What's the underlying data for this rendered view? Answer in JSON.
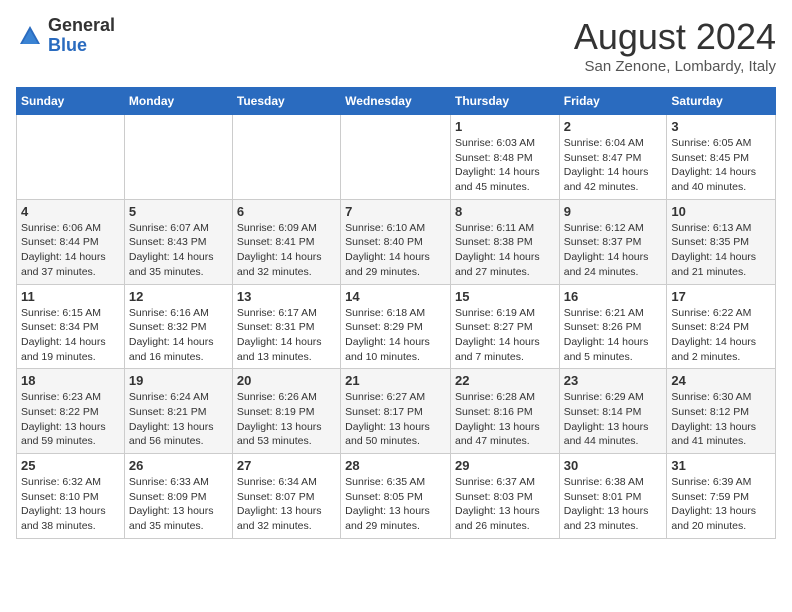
{
  "logo": {
    "general": "General",
    "blue": "Blue"
  },
  "header": {
    "title": "August 2024",
    "subtitle": "San Zenone, Lombardy, Italy"
  },
  "days_of_week": [
    "Sunday",
    "Monday",
    "Tuesday",
    "Wednesday",
    "Thursday",
    "Friday",
    "Saturday"
  ],
  "weeks": [
    [
      {
        "day": "",
        "info": ""
      },
      {
        "day": "",
        "info": ""
      },
      {
        "day": "",
        "info": ""
      },
      {
        "day": "",
        "info": ""
      },
      {
        "day": "1",
        "info": "Sunrise: 6:03 AM\nSunset: 8:48 PM\nDaylight: 14 hours and 45 minutes."
      },
      {
        "day": "2",
        "info": "Sunrise: 6:04 AM\nSunset: 8:47 PM\nDaylight: 14 hours and 42 minutes."
      },
      {
        "day": "3",
        "info": "Sunrise: 6:05 AM\nSunset: 8:45 PM\nDaylight: 14 hours and 40 minutes."
      }
    ],
    [
      {
        "day": "4",
        "info": "Sunrise: 6:06 AM\nSunset: 8:44 PM\nDaylight: 14 hours and 37 minutes."
      },
      {
        "day": "5",
        "info": "Sunrise: 6:07 AM\nSunset: 8:43 PM\nDaylight: 14 hours and 35 minutes."
      },
      {
        "day": "6",
        "info": "Sunrise: 6:09 AM\nSunset: 8:41 PM\nDaylight: 14 hours and 32 minutes."
      },
      {
        "day": "7",
        "info": "Sunrise: 6:10 AM\nSunset: 8:40 PM\nDaylight: 14 hours and 29 minutes."
      },
      {
        "day": "8",
        "info": "Sunrise: 6:11 AM\nSunset: 8:38 PM\nDaylight: 14 hours and 27 minutes."
      },
      {
        "day": "9",
        "info": "Sunrise: 6:12 AM\nSunset: 8:37 PM\nDaylight: 14 hours and 24 minutes."
      },
      {
        "day": "10",
        "info": "Sunrise: 6:13 AM\nSunset: 8:35 PM\nDaylight: 14 hours and 21 minutes."
      }
    ],
    [
      {
        "day": "11",
        "info": "Sunrise: 6:15 AM\nSunset: 8:34 PM\nDaylight: 14 hours and 19 minutes."
      },
      {
        "day": "12",
        "info": "Sunrise: 6:16 AM\nSunset: 8:32 PM\nDaylight: 14 hours and 16 minutes."
      },
      {
        "day": "13",
        "info": "Sunrise: 6:17 AM\nSunset: 8:31 PM\nDaylight: 14 hours and 13 minutes."
      },
      {
        "day": "14",
        "info": "Sunrise: 6:18 AM\nSunset: 8:29 PM\nDaylight: 14 hours and 10 minutes."
      },
      {
        "day": "15",
        "info": "Sunrise: 6:19 AM\nSunset: 8:27 PM\nDaylight: 14 hours and 7 minutes."
      },
      {
        "day": "16",
        "info": "Sunrise: 6:21 AM\nSunset: 8:26 PM\nDaylight: 14 hours and 5 minutes."
      },
      {
        "day": "17",
        "info": "Sunrise: 6:22 AM\nSunset: 8:24 PM\nDaylight: 14 hours and 2 minutes."
      }
    ],
    [
      {
        "day": "18",
        "info": "Sunrise: 6:23 AM\nSunset: 8:22 PM\nDaylight: 13 hours and 59 minutes."
      },
      {
        "day": "19",
        "info": "Sunrise: 6:24 AM\nSunset: 8:21 PM\nDaylight: 13 hours and 56 minutes."
      },
      {
        "day": "20",
        "info": "Sunrise: 6:26 AM\nSunset: 8:19 PM\nDaylight: 13 hours and 53 minutes."
      },
      {
        "day": "21",
        "info": "Sunrise: 6:27 AM\nSunset: 8:17 PM\nDaylight: 13 hours and 50 minutes."
      },
      {
        "day": "22",
        "info": "Sunrise: 6:28 AM\nSunset: 8:16 PM\nDaylight: 13 hours and 47 minutes."
      },
      {
        "day": "23",
        "info": "Sunrise: 6:29 AM\nSunset: 8:14 PM\nDaylight: 13 hours and 44 minutes."
      },
      {
        "day": "24",
        "info": "Sunrise: 6:30 AM\nSunset: 8:12 PM\nDaylight: 13 hours and 41 minutes."
      }
    ],
    [
      {
        "day": "25",
        "info": "Sunrise: 6:32 AM\nSunset: 8:10 PM\nDaylight: 13 hours and 38 minutes."
      },
      {
        "day": "26",
        "info": "Sunrise: 6:33 AM\nSunset: 8:09 PM\nDaylight: 13 hours and 35 minutes."
      },
      {
        "day": "27",
        "info": "Sunrise: 6:34 AM\nSunset: 8:07 PM\nDaylight: 13 hours and 32 minutes."
      },
      {
        "day": "28",
        "info": "Sunrise: 6:35 AM\nSunset: 8:05 PM\nDaylight: 13 hours and 29 minutes."
      },
      {
        "day": "29",
        "info": "Sunrise: 6:37 AM\nSunset: 8:03 PM\nDaylight: 13 hours and 26 minutes."
      },
      {
        "day": "30",
        "info": "Sunrise: 6:38 AM\nSunset: 8:01 PM\nDaylight: 13 hours and 23 minutes."
      },
      {
        "day": "31",
        "info": "Sunrise: 6:39 AM\nSunset: 7:59 PM\nDaylight: 13 hours and 20 minutes."
      }
    ]
  ]
}
